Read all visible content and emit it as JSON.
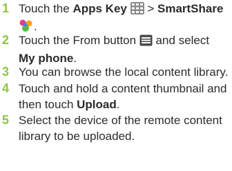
{
  "steps": [
    {
      "number": "1",
      "t1": "Touch the ",
      "b1": "Apps Key",
      "t2": " > ",
      "b2": "SmartShare",
      "t3": ".",
      "icons": [
        "apps-key-icon",
        "smartshare-app-icon"
      ]
    },
    {
      "number": "2",
      "t1": "Touch the From button ",
      "t2": " and select",
      "b1": "My phone",
      "t3": ".",
      "icons": [
        "from-button-icon"
      ]
    },
    {
      "number": "3",
      "t1": "You can browse the local content library."
    },
    {
      "number": "4",
      "t1": "Touch and hold a content thumbnail and then touch ",
      "b1": "Upload",
      "t2": "."
    },
    {
      "number": "5",
      "t1": "Select the device of the remote content library to be uploaded."
    }
  ],
  "colors": {
    "step_number": "#8dc63f",
    "text": "#2b2b2b"
  }
}
